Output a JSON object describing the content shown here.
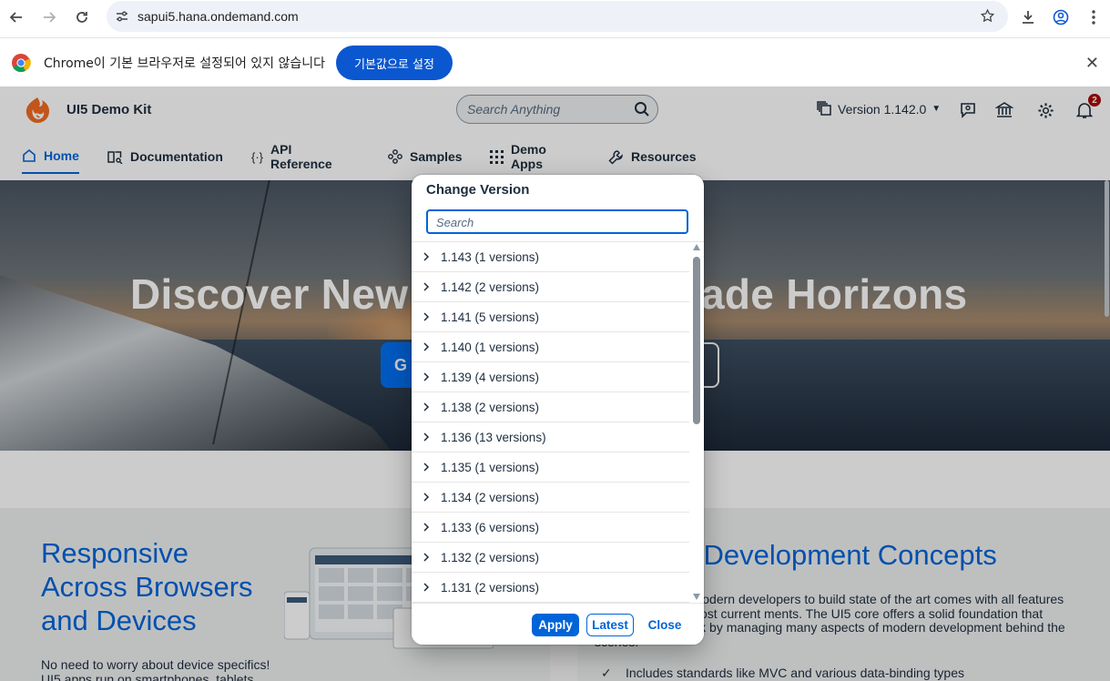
{
  "browser": {
    "url": "sapui5.hana.ondemand.com",
    "infobar_message": "Chrome이 기본 브라우저로 설정되어 있지 않습니다",
    "infobar_button": "기본값으로 설정"
  },
  "header": {
    "app_title": "UI5 Demo Kit",
    "search_placeholder": "Search Anything",
    "version_label": "Version 1.142.0",
    "notification_count": "2"
  },
  "tabs": [
    {
      "label": "Home",
      "icon": "home-icon",
      "active": true
    },
    {
      "label": "Documentation",
      "icon": "book-icon",
      "active": false
    },
    {
      "label": "API Reference",
      "icon": "braces-icon",
      "active": false
    },
    {
      "label": "Samples",
      "icon": "samples-icon",
      "active": false
    },
    {
      "label": "Demo Apps",
      "icon": "grid-icon",
      "active": false
    },
    {
      "label": "Resources",
      "icon": "wrench-icon",
      "active": false
    }
  ],
  "hero": {
    "title_left": "Discover New",
    "title_right": "ade Horizons",
    "button_left": "G",
    "button_right": "l"
  },
  "features": {
    "left_heading": "Responsive Across Browsers and Devices",
    "left_text": "No need to worry about device specifics! UI5 apps run on smartphones, tablets",
    "right_heading": "l Development Concepts",
    "right_text": "professionals for modern developers to build state of the art comes with all features needed to cover most current ments. The UI5 core offers a solid foundation that simplifies your work by managing many aspects of modern development behind the scenes:",
    "right_bullet": "Includes standards like MVC and various data-binding types"
  },
  "dialog": {
    "title": "Change Version",
    "search_placeholder": "Search",
    "versions": [
      "1.143 (1 versions)",
      "1.142 (2 versions)",
      "1.141 (5 versions)",
      "1.140 (1 versions)",
      "1.139 (4 versions)",
      "1.138 (2 versions)",
      "1.136 (13 versions)",
      "1.135 (1 versions)",
      "1.134 (2 versions)",
      "1.133 (6 versions)",
      "1.132 (2 versions)",
      "1.131 (2 versions)"
    ],
    "apply_label": "Apply",
    "latest_label": "Latest",
    "close_label": "Close"
  },
  "colors": {
    "brand_blue": "#0064d9",
    "chrome_blue": "#0b57d0",
    "badge_red": "#aa0808"
  }
}
